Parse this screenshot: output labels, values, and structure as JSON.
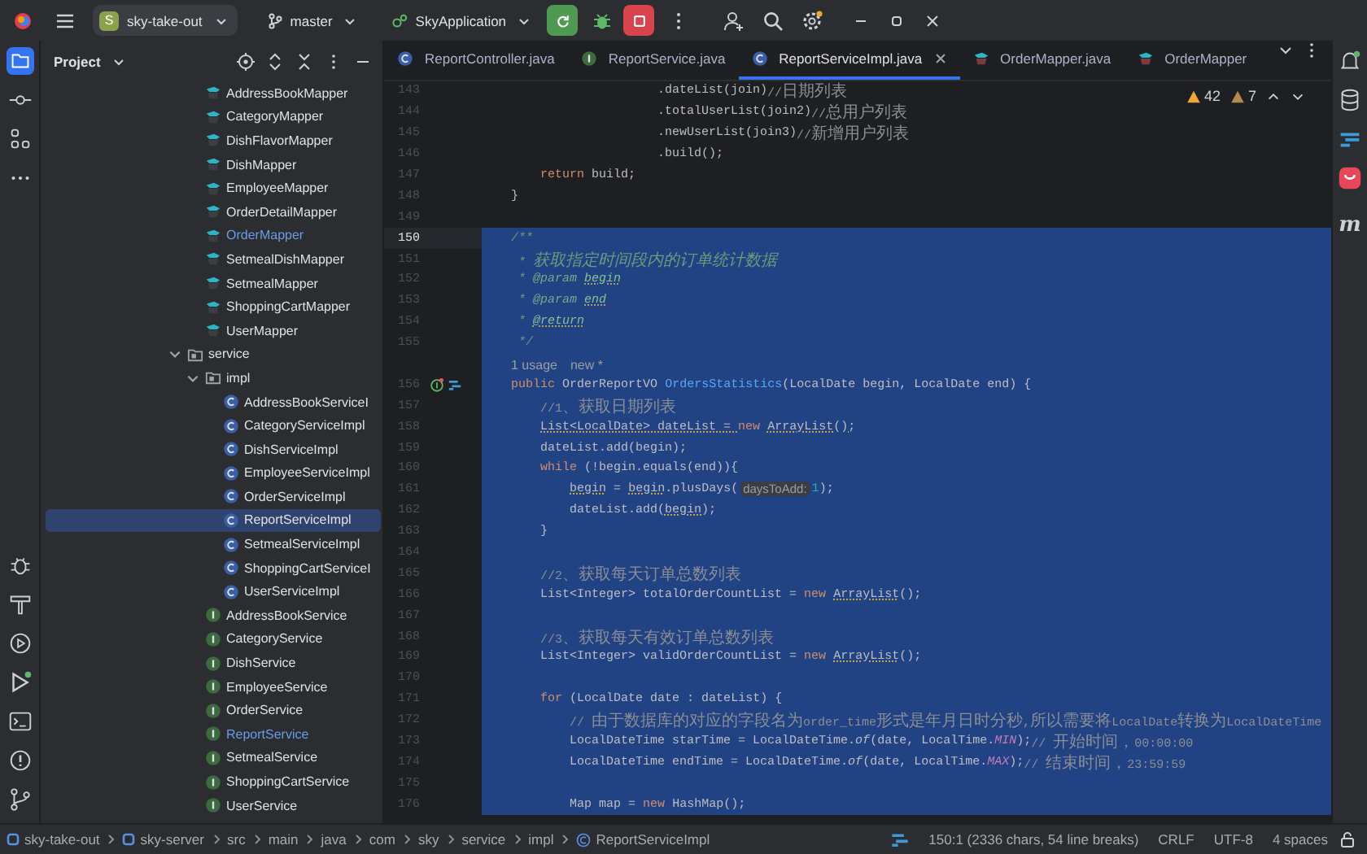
{
  "toolbar": {
    "project": {
      "badge": "S",
      "name": "sky-take-out"
    },
    "branch": "master",
    "run_config": "SkyApplication"
  },
  "project_panel": {
    "title": "Project",
    "tree_top": [
      {
        "name": "AddressBookMapper",
        "kind": "mapper",
        "selected": false,
        "changed": false
      },
      {
        "name": "CategoryMapper",
        "kind": "mapper",
        "selected": false,
        "changed": false
      },
      {
        "name": "DishFlavorMapper",
        "kind": "mapper",
        "selected": false,
        "changed": false
      },
      {
        "name": "DishMapper",
        "kind": "mapper",
        "selected": false,
        "changed": false
      },
      {
        "name": "EmployeeMapper",
        "kind": "mapper",
        "selected": false,
        "changed": false
      },
      {
        "name": "OrderDetailMapper",
        "kind": "mapper",
        "selected": false,
        "changed": false
      },
      {
        "name": "OrderMapper",
        "kind": "mapper",
        "selected": false,
        "changed": true
      },
      {
        "name": "SetmealDishMapper",
        "kind": "mapper",
        "selected": false,
        "changed": false
      },
      {
        "name": "SetmealMapper",
        "kind": "mapper",
        "selected": false,
        "changed": false
      },
      {
        "name": "ShoppingCartMapper",
        "kind": "mapper",
        "selected": false,
        "changed": false
      },
      {
        "name": "UserMapper",
        "kind": "mapper",
        "selected": false,
        "changed": false
      }
    ],
    "tree": [
      {
        "name": "service",
        "kind": "folder",
        "selected": false,
        "changed": false,
        "expanded": true,
        "children": [
          {
            "name": "impl",
            "kind": "folder",
            "selected": false,
            "changed": false,
            "expanded": true,
            "children": [
              {
                "name": "AddressBookServiceI",
                "kind": "class",
                "selected": false,
                "changed": false
              },
              {
                "name": "CategoryServiceImpl",
                "kind": "class",
                "selected": false,
                "changed": false
              },
              {
                "name": "DishServiceImpl",
                "kind": "class",
                "selected": false,
                "changed": false
              },
              {
                "name": "EmployeeServiceImpl",
                "kind": "class",
                "selected": false,
                "changed": false
              },
              {
                "name": "OrderServiceImpl",
                "kind": "class",
                "selected": false,
                "changed": false
              },
              {
                "name": "ReportServiceImpl",
                "kind": "class",
                "selected": true,
                "changed": false
              },
              {
                "name": "SetmealServiceImpl",
                "kind": "class",
                "selected": false,
                "changed": false
              },
              {
                "name": "ShoppingCartServiceI",
                "kind": "class",
                "selected": false,
                "changed": false
              },
              {
                "name": "UserServiceImpl",
                "kind": "class",
                "selected": false,
                "changed": false
              }
            ]
          },
          {
            "name": "AddressBookService",
            "kind": "interface",
            "selected": false,
            "changed": false
          },
          {
            "name": "CategoryService",
            "kind": "interface",
            "selected": false,
            "changed": false
          },
          {
            "name": "DishService",
            "kind": "interface",
            "selected": false,
            "changed": false
          },
          {
            "name": "EmployeeService",
            "kind": "interface",
            "selected": false,
            "changed": false
          },
          {
            "name": "OrderService",
            "kind": "interface",
            "selected": false,
            "changed": false
          },
          {
            "name": "ReportService",
            "kind": "interface",
            "selected": false,
            "changed": true
          },
          {
            "name": "SetmealService",
            "kind": "interface",
            "selected": false,
            "changed": false
          },
          {
            "name": "ShoppingCartService",
            "kind": "interface",
            "selected": false,
            "changed": false
          },
          {
            "name": "UserService",
            "kind": "interface",
            "selected": false,
            "changed": false
          }
        ]
      }
    ]
  },
  "editor": {
    "tabs": [
      {
        "label": "ReportController.java",
        "kind": "class",
        "selected": false
      },
      {
        "label": "ReportService.java",
        "kind": "interface",
        "selected": false
      },
      {
        "label": "ReportServiceImpl.java",
        "kind": "class",
        "selected": true
      },
      {
        "label": "OrderMapper.java",
        "kind": "mapper",
        "selected": false
      },
      {
        "label": "OrderMapper",
        "kind": "mapper",
        "selected": false
      }
    ],
    "warnings": "42",
    "weak_warnings": "7",
    "lines": [
      {
        "kind": "code",
        "number": "143",
        "selected": false,
        "current": false,
        "segments": [
          {
            "kind": "plain",
            "text": "                        .dateList(join)"
          },
          {
            "kind": "comment",
            "text": "//日期列表"
          }
        ]
      },
      {
        "kind": "code",
        "number": "144",
        "selected": false,
        "current": false,
        "segments": [
          {
            "kind": "plain",
            "text": "                        .totalUserList(join2)"
          },
          {
            "kind": "comment",
            "text": "//总用户列表"
          }
        ]
      },
      {
        "kind": "code",
        "number": "145",
        "selected": false,
        "current": false,
        "segments": [
          {
            "kind": "plain",
            "text": "                        .newUserList(join3)"
          },
          {
            "kind": "comment",
            "text": "//新增用户列表"
          }
        ]
      },
      {
        "kind": "code",
        "number": "146",
        "selected": false,
        "current": false,
        "segments": [
          {
            "kind": "plain",
            "text": "                        .build();"
          }
        ]
      },
      {
        "kind": "code",
        "number": "147",
        "selected": false,
        "current": false,
        "segments": [
          {
            "kind": "keyword",
            "text": "        return"
          },
          {
            "kind": "plain",
            "text": " build;"
          }
        ]
      },
      {
        "kind": "code",
        "number": "148",
        "selected": false,
        "current": false,
        "segments": [
          {
            "kind": "plain",
            "text": "    }"
          }
        ]
      },
      {
        "kind": "code",
        "number": "149",
        "selected": false,
        "current": false
      },
      {
        "kind": "code",
        "number": "150",
        "selected": true,
        "current": true,
        "segments": [
          {
            "kind": "doc",
            "text": "    /**"
          }
        ]
      },
      {
        "kind": "code",
        "number": "151",
        "selected": true,
        "current": false,
        "segments": [
          {
            "kind": "doc",
            "text": "     * 获取指定时间段内的订单统计数据"
          }
        ]
      },
      {
        "kind": "code",
        "number": "152",
        "selected": true,
        "current": false,
        "segments": [
          {
            "kind": "doc",
            "text": "     * "
          },
          {
            "kind": "doctag",
            "text": "@param "
          },
          {
            "kind": "docref",
            "text": "begin"
          }
        ]
      },
      {
        "kind": "code",
        "number": "153",
        "selected": true,
        "current": false,
        "segments": [
          {
            "kind": "doc",
            "text": "     * "
          },
          {
            "kind": "doctag",
            "text": "@param "
          },
          {
            "kind": "docref",
            "text": "end"
          }
        ]
      },
      {
        "kind": "code",
        "number": "154",
        "selected": true,
        "current": false,
        "segments": [
          {
            "kind": "doc",
            "text": "     * "
          },
          {
            "kind": "docref",
            "text": "@return"
          }
        ]
      },
      {
        "kind": "code",
        "number": "155",
        "selected": true,
        "current": false,
        "segments": [
          {
            "kind": "doc",
            "text": "     */"
          }
        ]
      },
      {
        "kind": "inlay",
        "selected": true,
        "current": false,
        "usages": "1 usage",
        "author": "new *"
      },
      {
        "kind": "decl",
        "number": "156",
        "selected": true,
        "current": false,
        "segments": [
          {
            "kind": "keyword",
            "text": "    public"
          },
          {
            "kind": "plain",
            "text": " OrderReportVO "
          },
          {
            "kind": "method",
            "text": "OrdersStatistics"
          },
          {
            "kind": "plain",
            "text": "(LocalDate begin, LocalDate end) {"
          }
        ]
      },
      {
        "kind": "code",
        "number": "157",
        "selected": true,
        "current": false,
        "segments": [
          {
            "kind": "comment",
            "text": "        //1、获取日期列表"
          }
        ]
      },
      {
        "kind": "code",
        "number": "158",
        "selected": true,
        "current": false,
        "segments": [
          {
            "kind": "warn",
            "text": "        List<LocalDate> dateList = "
          },
          {
            "kind": "keyword",
            "text": "new "
          },
          {
            "kind": "warn",
            "text": "ArrayList();"
          }
        ]
      },
      {
        "kind": "code",
        "number": "159",
        "selected": true,
        "current": false,
        "segments": [
          {
            "kind": "plain",
            "text": "        dateList.add(begin);"
          }
        ]
      },
      {
        "kind": "code",
        "number": "160",
        "selected": true,
        "current": false,
        "segments": [
          {
            "kind": "keyword",
            "text": "        while"
          },
          {
            "kind": "plain",
            "text": " (!begin.equals(end)){"
          }
        ]
      },
      {
        "kind": "code",
        "number": "161",
        "selected": true,
        "current": false,
        "segments": [
          {
            "kind": "warn",
            "text": "            begin"
          },
          {
            "kind": "plain",
            "text": " = "
          },
          {
            "kind": "warn",
            "text": "begin"
          },
          {
            "kind": "plain",
            "text": ".plusDays("
          },
          {
            "kind": "hint",
            "text": "daysToAdd:"
          },
          {
            "kind": "number",
            "text": "1"
          },
          {
            "kind": "plain",
            "text": ");"
          }
        ]
      },
      {
        "kind": "code",
        "number": "162",
        "selected": true,
        "current": false,
        "segments": [
          {
            "kind": "plain",
            "text": "            dateList.add("
          },
          {
            "kind": "warn",
            "text": "begin"
          },
          {
            "kind": "plain",
            "text": ");"
          }
        ]
      },
      {
        "kind": "code",
        "number": "163",
        "selected": true,
        "current": false,
        "segments": [
          {
            "kind": "plain",
            "text": "        }"
          }
        ]
      },
      {
        "kind": "code",
        "number": "164",
        "selected": true,
        "current": false
      },
      {
        "kind": "code",
        "number": "165",
        "selected": true,
        "current": false,
        "segments": [
          {
            "kind": "comment",
            "text": "        //2、获取每天订单总数列表"
          }
        ]
      },
      {
        "kind": "code",
        "number": "166",
        "selected": true,
        "current": false,
        "segments": [
          {
            "kind": "plain",
            "text": "        List<Integer> totalOrderCountList = "
          },
          {
            "kind": "keyword",
            "text": "new "
          },
          {
            "kind": "warn",
            "text": "ArrayList"
          },
          {
            "kind": "plain",
            "text": "();"
          }
        ]
      },
      {
        "kind": "code",
        "number": "167",
        "selected": true,
        "current": false
      },
      {
        "kind": "code",
        "number": "168",
        "selected": true,
        "current": false,
        "segments": [
          {
            "kind": "comment",
            "text": "        //3、获取每天有效订单总数列表"
          }
        ]
      },
      {
        "kind": "code",
        "number": "169",
        "selected": true,
        "current": false,
        "segments": [
          {
            "kind": "plain",
            "text": "        List<Integer> validOrderCountList = "
          },
          {
            "kind": "keyword",
            "text": "new "
          },
          {
            "kind": "warn",
            "text": "ArrayList"
          },
          {
            "kind": "plain",
            "text": "();"
          }
        ]
      },
      {
        "kind": "code",
        "number": "170",
        "selected": true,
        "current": false
      },
      {
        "kind": "code",
        "number": "171",
        "selected": true,
        "current": false,
        "segments": [
          {
            "kind": "keyword",
            "text": "        for"
          },
          {
            "kind": "plain",
            "text": " (LocalDate date : dateList) {"
          }
        ]
      },
      {
        "kind": "code",
        "number": "172",
        "selected": true,
        "current": false,
        "segments": [
          {
            "kind": "comment",
            "text": "            // 由于数据库的对应的字段名为order_time形式是年月日时分秒,所以需要将LocalDate转换为LocalDateTime"
          }
        ]
      },
      {
        "kind": "code",
        "number": "173",
        "selected": true,
        "current": false,
        "segments": [
          {
            "kind": "plain",
            "text": "            LocalDateTime starTime = LocalDateTime."
          },
          {
            "kind": "static",
            "text": "of"
          },
          {
            "kind": "plain",
            "text": "(date, LocalTime."
          },
          {
            "kind": "const",
            "text": "MIN"
          },
          {
            "kind": "plain",
            "text": ");"
          },
          {
            "kind": "comment",
            "text": "// 开始时间，00:00:00"
          }
        ]
      },
      {
        "kind": "code",
        "number": "174",
        "selected": true,
        "current": false,
        "segments": [
          {
            "kind": "plain",
            "text": "            LocalDateTime endTime = LocalDateTime."
          },
          {
            "kind": "static",
            "text": "of"
          },
          {
            "kind": "plain",
            "text": "(date, LocalTime."
          },
          {
            "kind": "const",
            "text": "MAX"
          },
          {
            "kind": "plain",
            "text": ");"
          },
          {
            "kind": "comment",
            "text": "// 结束时间，23:59:59"
          }
        ]
      },
      {
        "kind": "code",
        "number": "175",
        "selected": true,
        "current": false
      },
      {
        "kind": "code",
        "number": "176",
        "selected": true,
        "current": false,
        "segments": [
          {
            "kind": "plain",
            "text": "            Map map = "
          },
          {
            "kind": "keyword",
            "text": "new"
          },
          {
            "kind": "plain",
            "text": " HashMap();"
          }
        ]
      }
    ]
  },
  "right_toolbar": {
    "maven_label": "m"
  },
  "breadcrumb": [
    {
      "label": "sky-take-out",
      "kind": "module"
    },
    {
      "label": "sky-server",
      "kind": "module"
    },
    {
      "label": "src",
      "kind": "dir"
    },
    {
      "label": "main",
      "kind": "dir"
    },
    {
      "label": "java",
      "kind": "dir"
    },
    {
      "label": "com",
      "kind": "dir"
    },
    {
      "label": "sky",
      "kind": "dir"
    },
    {
      "label": "service",
      "kind": "dir"
    },
    {
      "label": "impl",
      "kind": "dir"
    },
    {
      "label": "ReportServiceImpl",
      "kind": "class"
    }
  ],
  "status": {
    "position": "150:1 (2336 chars, 54 line breaks)",
    "line_separator": "CRLF",
    "encoding": "UTF-8",
    "indent": "4 spaces"
  }
}
